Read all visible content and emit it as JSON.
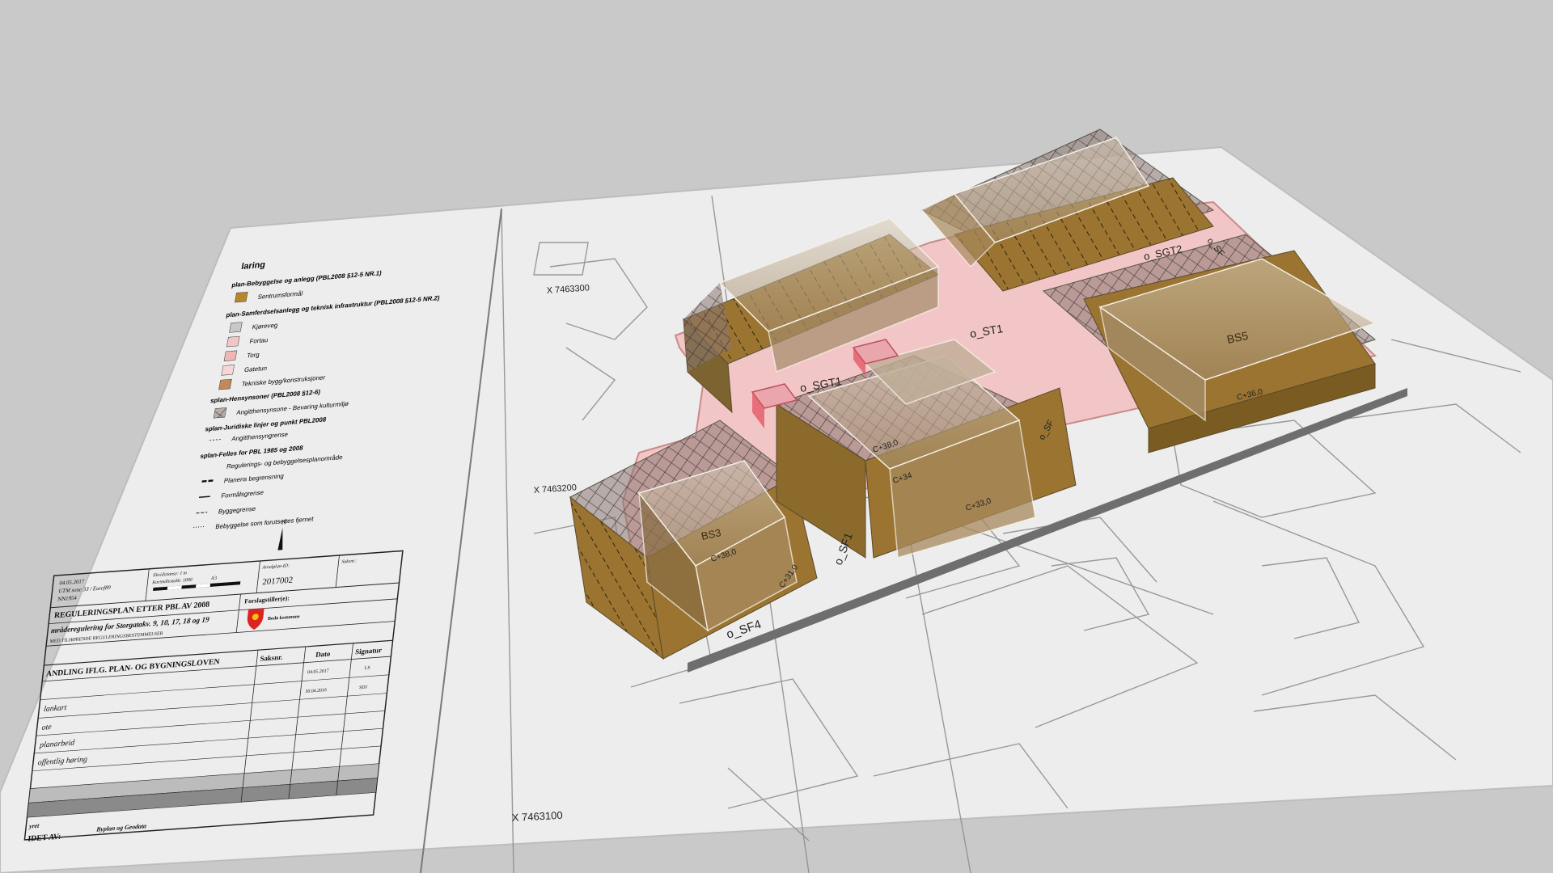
{
  "legend": {
    "title": "laring",
    "section_bebyggelse": "plan-Bebyggelse og anlegg (PBL2008 §12-5 NR.1)",
    "sentrumsformal": "Sentrumsformål",
    "section_samferdsel": "plan-Samferdselsanlegg og teknisk infrastruktur (PBL2008 §12-5 NR.2)",
    "kjoreveg": "Kjøreveg",
    "fortau": "Fortau",
    "torg": "Torg",
    "gatetun": "Gatetun",
    "tekniske": "Tekniske bygg/konstruksjoner",
    "section_hensynsoner": "splan-Hensynsoner (PBL2008 §12-6)",
    "angitthensynsone": "Angitthensynsone - Bevaring kulturmiljø",
    "section_juridiske": "splan-Juridiske linjer og punkt PBL2008",
    "angitthensyngrense": "Angitthensyngrense",
    "section_felles": "splan-Felles for PBL 1985 og 2008",
    "regulerings": "Regulerings- og bebyggelsesplanområde",
    "planens": "Planens begrensning",
    "formalsgrense": "Formålsgrense",
    "byggegrense": "Byggegrense",
    "bebyggelse_fjernet": "Bebyggelse som forutsettes fjernet"
  },
  "title_block": {
    "date1": "04.05.2017",
    "utm": "UTM sone 33 / Euref89",
    "nn": "NN1954",
    "ekvidistanse": "Ekvidistanse: 1 m",
    "kartmalestokk": "Kartmålestokk: 1000",
    "format": "A3",
    "north": "N",
    "arealplan_label": "Arealplan-ID:",
    "arealplan_id": "2017002",
    "saksnr_label": "Saksnr.:",
    "plan_title": "REGULERINGSPLAN ETTER PBL AV 2008",
    "plan_subtitle": "mråderegulering for Storgatakv. 9, 10, 17, 18 og 19",
    "tilhorende": "MED TILHØRENDE REGULERINGSBESTEMMELSER",
    "forslagstiller": "Forslagstiller(e):",
    "kommune": "Bodø kommune",
    "behandling": "ANDLING IFLG. PLAN- OG BYGNINGSLOVEN",
    "col_saksnr": "Saksnr.",
    "col_dato": "Dato",
    "col_signatur": "Signatur",
    "row1_date": "04.05.2017",
    "row1_sign": "LS",
    "row2_label": "lankart",
    "row2_date": "30.04.2016",
    "row2_sign": "SDJ",
    "row3_label": "ote",
    "row4_label": "planarbeid",
    "row5_label": "offentlig høring",
    "footer_label": "yret",
    "utarbeidet": "IDET AV:",
    "utarbeidet_by": "Byplan og Geodata"
  },
  "map": {
    "coord_top": "X 7463300",
    "coord_mid": "X 7463200",
    "coord_bottom": "X 7463100",
    "label_st1": "o_ST1",
    "label_sgt1": "o_SGT1",
    "label_sgt2": "o_SGT2",
    "label_sf1": "o_SF1",
    "label_sf4": "o_SF4",
    "label_sf_top": "o_SF",
    "label_sf_mid": "o_SF",
    "label_bs3": "BS3",
    "label_bs5": "BS5",
    "h_bs3_a": "C+38,0",
    "h_bs3_b": "C+31,0",
    "h_mid_a": "C+38,0",
    "h_mid_b": "C+33,0",
    "h_mid_c": "C+34",
    "h_bs5": "C+36,0"
  },
  "colors": {
    "background": "#c9c9c9",
    "paper": "#eeeeee",
    "road_pink": "#f2c6c6",
    "building_brown": "#9a7430",
    "building_glass": "#c9b9a0",
    "hatch": "#6b5a52",
    "torg_red": "#e24a5b",
    "sentrum": "#b8862a"
  }
}
